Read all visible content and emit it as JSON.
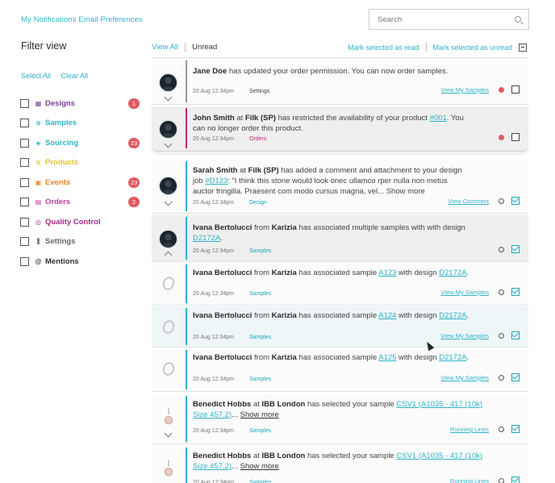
{
  "header": {
    "breadcrumb": "My Notifications Email Preferences",
    "search_placeholder": "Search"
  },
  "filter": {
    "title": "Filter view",
    "select_all": "Select All",
    "clear_all": "Clear All",
    "items": [
      {
        "label": "Designs",
        "icon": "designs-icon",
        "glyph": "▦",
        "color": "#7b3f9e",
        "badge": "1"
      },
      {
        "label": "Samples",
        "icon": "samples-icon",
        "glyph": "≋",
        "color": "#2fb3c9",
        "badge": ""
      },
      {
        "label": "Sourcing",
        "icon": "sourcing-icon",
        "glyph": "◈",
        "color": "#2fb3c9",
        "badge": "23"
      },
      {
        "label": "Products",
        "icon": "products-icon",
        "glyph": "≋",
        "color": "#e8c234",
        "badge": ""
      },
      {
        "label": "Events",
        "icon": "events-icon",
        "glyph": "▣",
        "color": "#e8862e",
        "badge": "23"
      },
      {
        "label": "Orders",
        "icon": "orders-icon",
        "glyph": "▤",
        "color": "#c040a0",
        "badge": "2"
      },
      {
        "label": "Quality Control",
        "icon": "quality-control-icon",
        "glyph": "◎",
        "color": "#a02d8c",
        "badge": ""
      },
      {
        "label": "Settings",
        "icon": "settings-icon",
        "glyph": "⫼",
        "color": "#666666",
        "badge": ""
      },
      {
        "label": "Mentions",
        "icon": "mentions-icon",
        "glyph": "@",
        "color": "#333333",
        "badge": ""
      }
    ]
  },
  "tabs": {
    "all": "View All",
    "unread": "Unread"
  },
  "actions": {
    "mark_read": "Mark selected as read",
    "mark_unread": "Mark selected as unread"
  },
  "notifications": [
    {
      "lines": [
        "<b>Jane Doe</b> has updated your order permission. You can now order samples."
      ],
      "date": "20 Aug 12:34pm",
      "tag": "Settings",
      "tag_color": "#444444",
      "action": "View My Samples",
      "status": "unread",
      "checked": false,
      "bar": "#999999"
    },
    {
      "lines": [
        "<b>John Smith</b> at <b>Filk (SP)</b> has restricted the availability of your product <span class='lnk'>#001</span>. You",
        "can no longer order this product."
      ],
      "date": "20 Aug 12:34pm",
      "tag": "Orders",
      "tag_color": "#c0267a",
      "action": "",
      "status": "unread",
      "checked": false,
      "bar": "#c0267a"
    },
    {
      "lines": [
        "<b>Sarah Smith</b> at <b>Filk (SP)</b>  has added a comment and attachment to your design",
        "job <span class='lnk'>#D123</span>: “I think this stone would look onec ullamco rper nulla non metus",
        "auctor fringilla. Praesent com modo cursus magna, vel... Show more"
      ],
      "date": "20 Aug 12:34pm",
      "tag": "Design",
      "tag_color": "#1aa6b9",
      "action": "View Comment",
      "status": "read",
      "checked": true,
      "bar": "#2fb3c9"
    },
    {
      "lines": [
        " <b>Ivana Bertolucci</b> from <b>Karizia</b> has associated multiple samples with with design",
        "<span class='lnk'>D2172A</span>."
      ],
      "date": "20 Aug 12:34pm",
      "tag": "Samples",
      "tag_color": "#1aa6b9",
      "action": "",
      "status": "read",
      "checked": true,
      "bar": "#2fb3c9"
    },
    {
      "lines": [
        "<b>Ivana Bertolucci</b> from <b>Karizia</b> has associated sample <span class='lnk'>A123</span> with design <span class='lnk'>D2172A</span>."
      ],
      "date": "20 Aug 12:34pm",
      "tag": "Samples",
      "tag_color": "#1aa6b9",
      "action": "View My Samples",
      "status": "read",
      "checked": true,
      "bar": "#2fb3c9"
    },
    {
      "lines": [
        "<b>Ivana Bertolucci</b> from <b>Karizia</b> has associated sample <span class='lnk'>A124</span> with design <span class='lnk'>D2172A</span>."
      ],
      "date": "20 Aug 12:34pm",
      "tag": "Samples",
      "tag_color": "#1aa6b9",
      "action": "View My Samples",
      "status": "read",
      "checked": true,
      "bar": "#2fb3c9"
    },
    {
      "lines": [
        "<b>Ivana Bertolucci</b> from <b>Karizia</b> has associated sample <span class='lnk'>A125</span> with design <span class='lnk'>D2172A</span>."
      ],
      "date": "20 Aug 12:34pm",
      "tag": "Samples",
      "tag_color": "#1aa6b9",
      "action": "View My Samples",
      "status": "read",
      "checked": true,
      "bar": "#2fb3c9"
    },
    {
      "lines": [
        "<b>Benedict Hobbs</b> at <b>IBB London</b> has selected your sample <span class='lnk'>CSV1 (A1035 - 417 (10k)</span>",
        "<span class='lnk'>Size 457.2)</span>... <span class='more'>Show more</span>"
      ],
      "date": "20 Aug 12:34pm",
      "tag": "Samples",
      "tag_color": "#1aa6b9",
      "action": "Running Lines",
      "status": "read",
      "checked": true,
      "bar": "#2fb3c9"
    },
    {
      "lines": [
        "<b>Benedict Hobbs</b> at <b>IBB London</b> has selected your sample <span class='lnk'>CSV1 (A1035 - 417 (10k)</span>",
        "<span class='lnk'>Size 457.2)</span>... <span class='more'>Show more</span>"
      ],
      "date": "20 Aug 12:34pm",
      "tag": "Samples",
      "tag_color": "#1aa6b9",
      "action": "Running Lines",
      "status": "read",
      "checked": true,
      "bar": "#2fb3c9"
    }
  ]
}
